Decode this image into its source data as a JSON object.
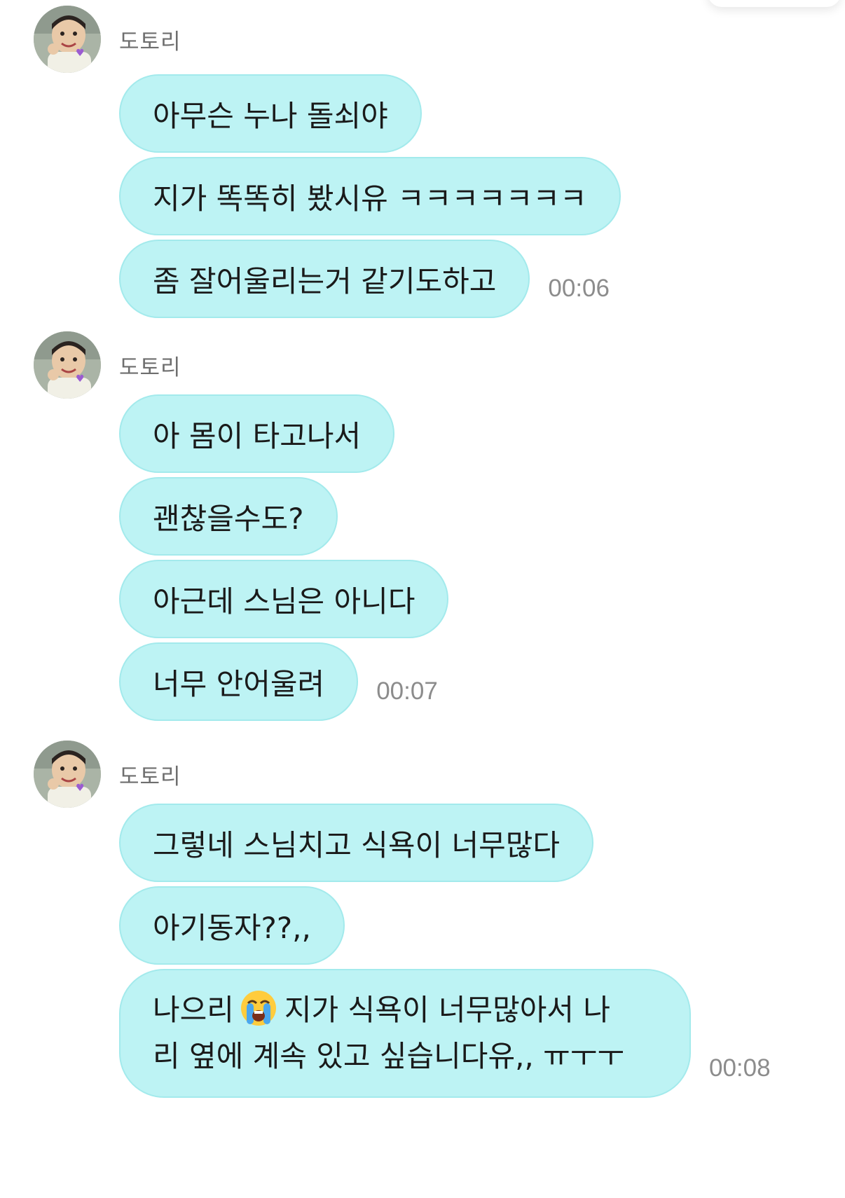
{
  "groups": [
    {
      "sender": "도토리",
      "messages": [
        {
          "text": "아무슨 누나 돌쇠야",
          "time": ""
        },
        {
          "text": "지가 똑똑히 봤시유 ㅋㅋㅋㅋㅋㅋㅋ",
          "time": ""
        },
        {
          "text": "좀 잘어울리는거 같기도하고",
          "time": "00:06"
        }
      ]
    },
    {
      "sender": "도토리",
      "messages": [
        {
          "text": "아 몸이 타고나서",
          "time": ""
        },
        {
          "text": "괜찮을수도?",
          "time": ""
        },
        {
          "text": "아근데 스님은 아니다",
          "time": ""
        },
        {
          "text": "너무 안어울려",
          "time": "00:07"
        }
      ]
    },
    {
      "sender": "도토리",
      "messages": [
        {
          "text": "그렇네 스님치고 식욕이 너무많다",
          "time": ""
        },
        {
          "text": "아기동자??,,",
          "time": ""
        },
        {
          "text_before_emoji": "나으리",
          "emoji": "loudly-crying-face-emoji",
          "text_after_emoji": "지가 식욕이 너무많아서 나",
          "text_line2": "리 옆에 계속 있고 싶습니다유,, ㅠㅜㅜ",
          "time": "00:08"
        }
      ]
    }
  ],
  "colors": {
    "bubble": "#bdf3f4",
    "bubble_border": "#a3eaec",
    "time": "#8c8c8c",
    "sender": "#6e6e6e"
  }
}
